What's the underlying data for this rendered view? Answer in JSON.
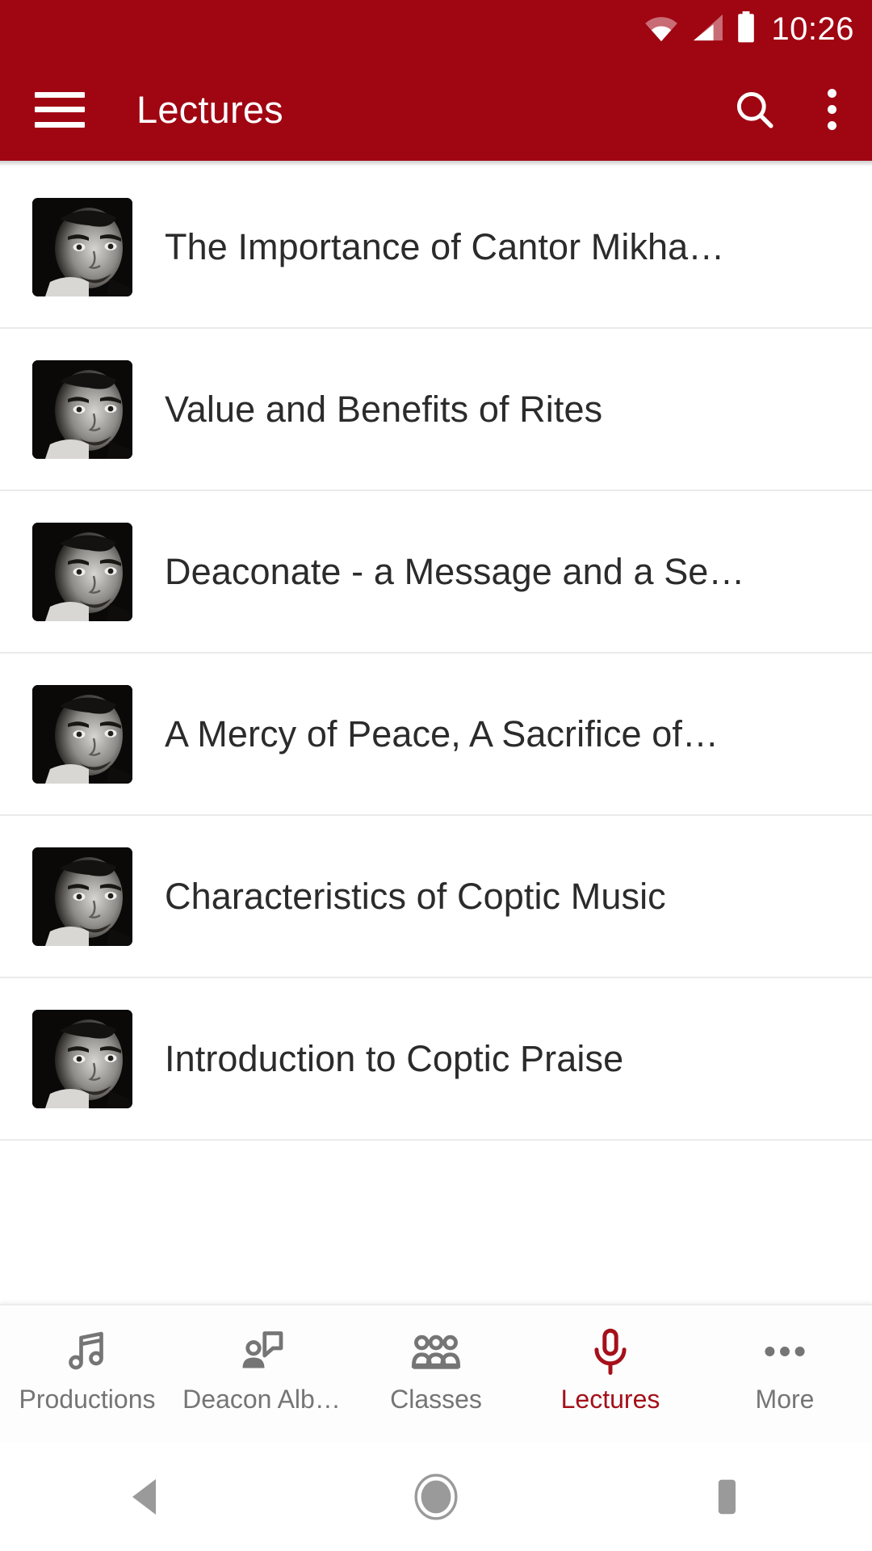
{
  "status_bar": {
    "time": "10:26",
    "icons": [
      "wifi-icon",
      "cellular-signal-icon",
      "battery-icon"
    ]
  },
  "app_bar": {
    "menu_icon": "hamburger-menu-icon",
    "title": "Lectures",
    "search_icon": "search-icon",
    "overflow_icon": "overflow-menu-icon",
    "background_color": "#A00512",
    "text_color": "#FFFFFF"
  },
  "list": {
    "items": [
      {
        "title": "The Importance of Cantor Mikha…",
        "thumbnail": "speaker-portrait-thumbnail"
      },
      {
        "title": "Value and Benefits of Rites",
        "thumbnail": "speaker-portrait-thumbnail"
      },
      {
        "title": "Deaconate - a Message and a Se…",
        "thumbnail": "speaker-portrait-thumbnail"
      },
      {
        "title": "A Mercy of Peace, A Sacrifice of…",
        "thumbnail": "speaker-portrait-thumbnail"
      },
      {
        "title": "Characteristics of Coptic Music",
        "thumbnail": "speaker-portrait-thumbnail"
      },
      {
        "title": "Introduction to Coptic Praise",
        "thumbnail": "speaker-portrait-thumbnail"
      }
    ]
  },
  "bottom_nav": {
    "active_color": "#A5101A",
    "inactive_color": "#757575",
    "items": [
      {
        "label": "Productions",
        "icon": "music-note-icon",
        "active": false
      },
      {
        "label": "Deacon Alb…",
        "icon": "person-speech-bubble-icon",
        "active": false
      },
      {
        "label": "Classes",
        "icon": "group-people-icon",
        "active": false
      },
      {
        "label": "Lectures",
        "icon": "microphone-icon",
        "active": true
      },
      {
        "label": "More",
        "icon": "more-horizontal-icon",
        "active": false
      }
    ]
  },
  "system_nav": {
    "back_icon": "back-triangle-icon",
    "home_icon": "home-circle-icon",
    "recents_icon": "recents-square-icon"
  }
}
